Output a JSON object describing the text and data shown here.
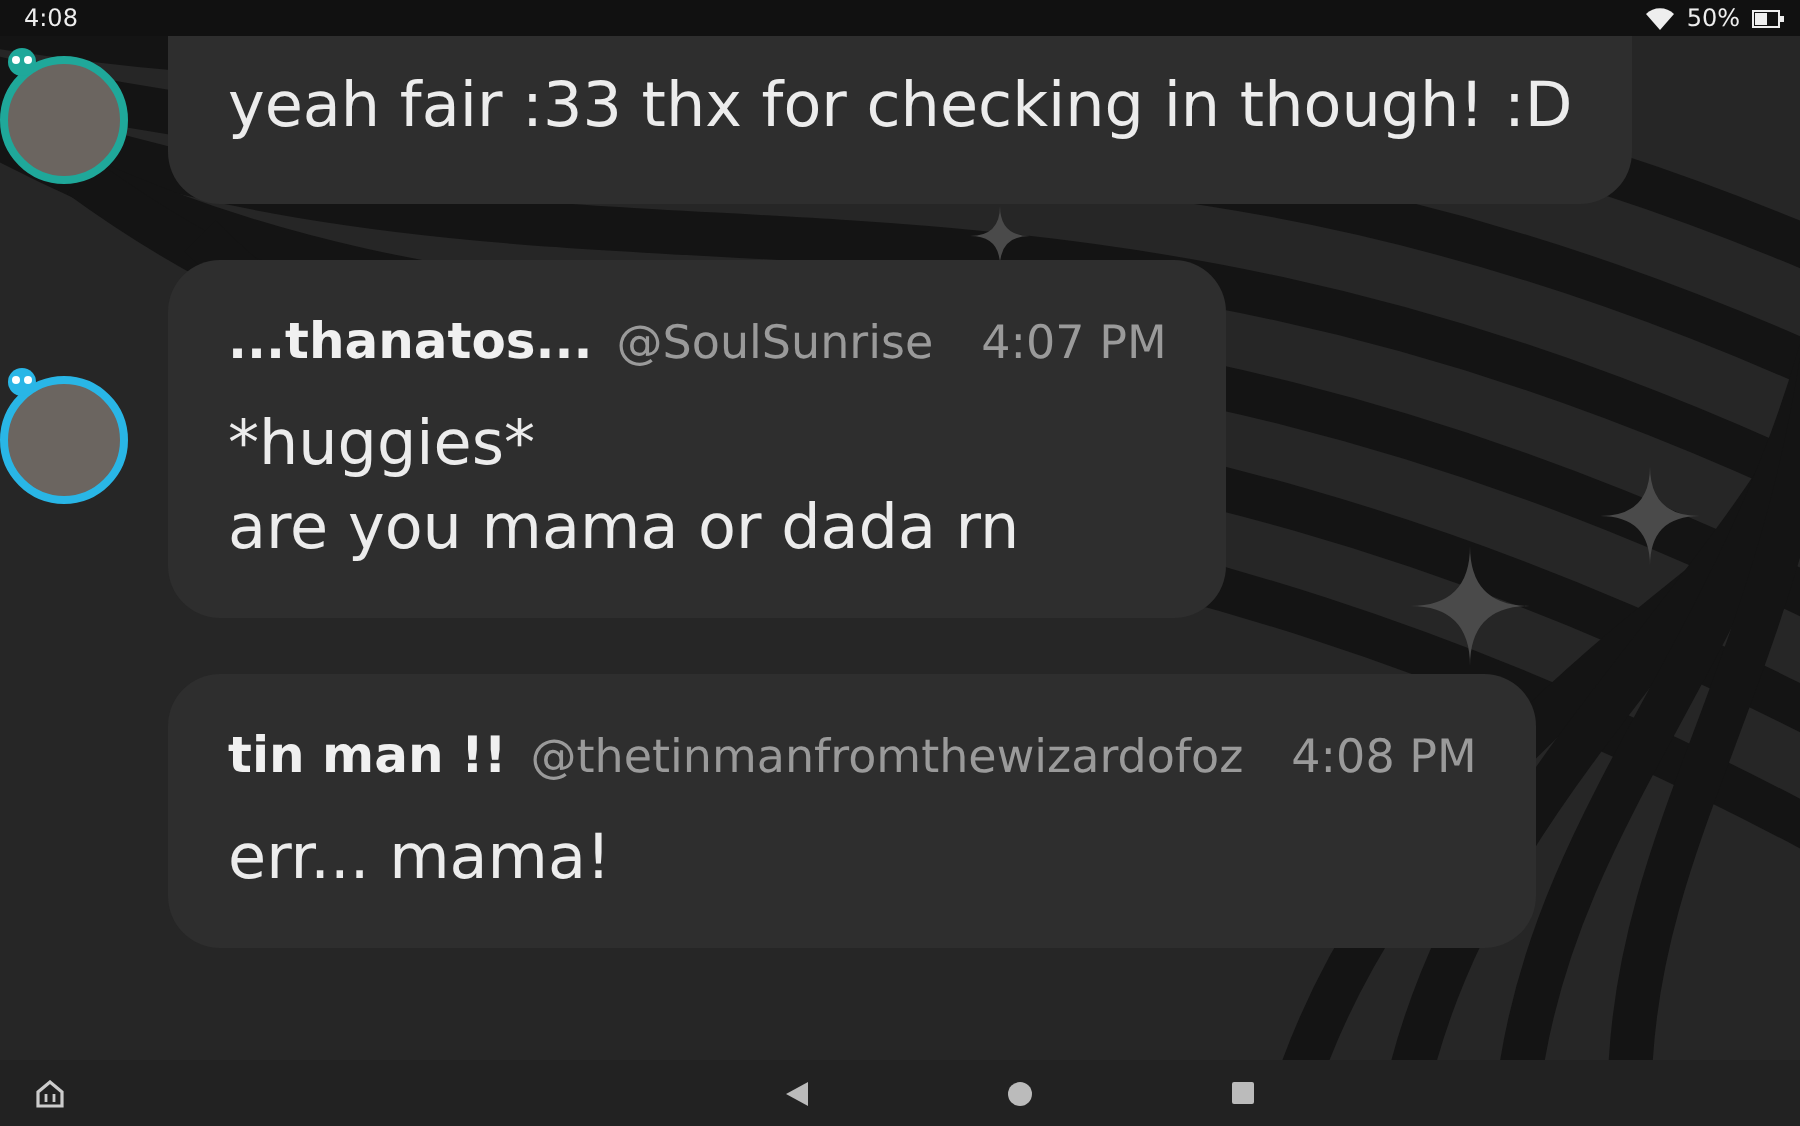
{
  "status_bar": {
    "time": "4:08",
    "battery": "50%"
  },
  "messages": [
    {
      "avatar": {
        "color": "#1fa89a"
      },
      "lines": [
        "yeah fair :33 thx for checking in though! :D"
      ]
    },
    {
      "avatar": {
        "color": "#29b6e6"
      },
      "author": "...thanatos...",
      "handle": "@SoulSunrise",
      "time": "4:07 PM",
      "lines": [
        "*huggies*",
        "are you mama or dada rn"
      ]
    },
    {
      "author": "tin man !!",
      "handle": "@thetinmanfromthewizardofoz",
      "time": "4:08 PM",
      "lines": [
        "err... mama!"
      ]
    }
  ]
}
